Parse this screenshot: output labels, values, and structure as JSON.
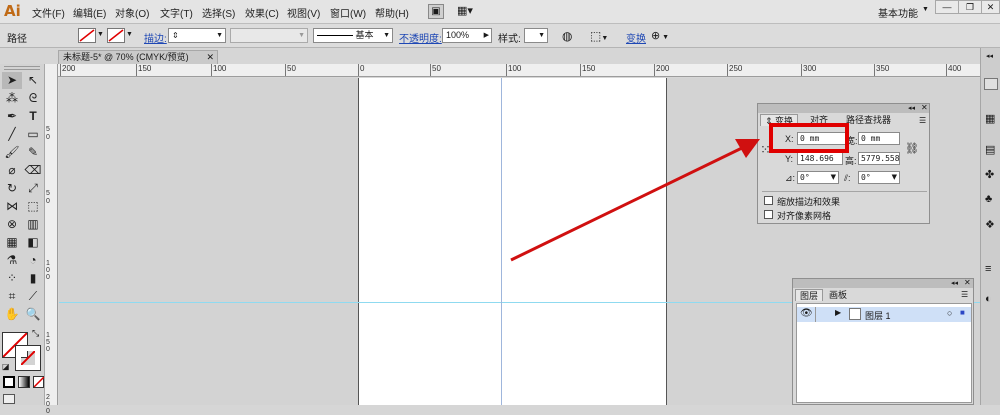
{
  "app": {
    "logo": "Ai"
  },
  "menu": [
    "文件(F)",
    "编辑(E)",
    "对象(O)",
    "文字(T)",
    "选择(S)",
    "效果(C)",
    "视图(V)",
    "窗口(W)",
    "帮助(H)"
  ],
  "workspace": "基本功能",
  "control_bar": {
    "selection_label": "路径",
    "stroke_label": "描边:",
    "stroke_style": "基本",
    "opacity_label": "不透明度:",
    "opacity_value": "100%",
    "style_label": "样式:",
    "transform_link": "变换"
  },
  "document_tab": "未标题-5* @ 70% (CMYK/预览)",
  "ruler": {
    "h_ticks": [
      "200",
      "150",
      "100",
      "50",
      "0",
      "50",
      "100",
      "150",
      "200",
      "250",
      "300",
      "350",
      "400"
    ],
    "v_ticks": [
      "5",
      "0",
      "5",
      "0",
      "1 0 0",
      "1 5 0",
      "2 0 0"
    ]
  },
  "transform_panel": {
    "tabs": [
      "变换",
      "对齐",
      "路径查找器"
    ],
    "x_label": "X:",
    "x_value": "0 mm",
    "w_label": "宽:",
    "w_value": "0 mm",
    "y_label": "Y:",
    "y_value": "148.696",
    "h_label": "高:",
    "h_value": "5779.558",
    "rotate_value": "0°",
    "shear_value": "0°",
    "options": [
      "缩放描边和效果",
      "对齐像素网格"
    ]
  },
  "layers_panel": {
    "tabs": [
      "图层",
      "画板"
    ],
    "layers": [
      {
        "name": "图层 1"
      }
    ]
  },
  "colors": {
    "highlight_box": "#e00000",
    "arrow": "#d01010",
    "guide": "#8fdaf0",
    "selection_row": "#cfe0f7"
  }
}
